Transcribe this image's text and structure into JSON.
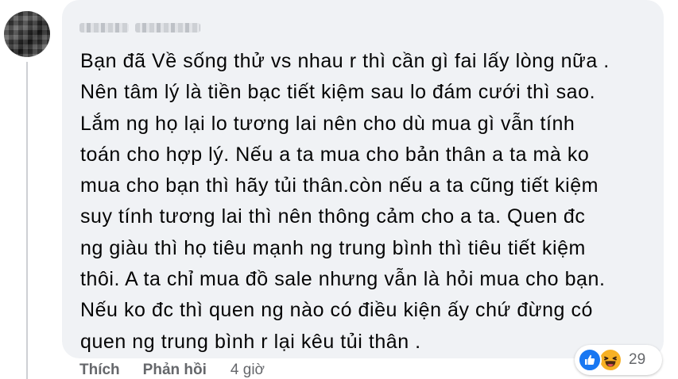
{
  "comment": {
    "author": "",
    "lines": [
      "Bạn đã Về sống thử vs nhau r thì cần gì fai lấy lòng nữa .",
      "Nên tâm lý là tiền bạc tiết kiệm sau lo đám cưới thì sao.",
      "Lắm ng họ lại lo tương lai nên cho dù mua gì vẫn tính",
      "toán cho hợp lý. Nếu a ta mua cho bản thân a ta mà ko",
      "mua cho bạn thì hãy tủi thân.còn nếu a ta cũng tiết kiệm",
      "suy tính tương lai thì nên thông cảm cho a ta. Quen đc",
      "ng giàu thì họ tiêu mạnh ng trung bình thì tiêu tiết kiệm",
      "thôi. A ta chỉ mua đồ sale nhưng vẫn là hỏi mua cho bạn.",
      "Nếu ko đc thì quen ng nào có điều kiện ấy chứ đừng có",
      "quen ng trung bình r lại kêu tủi thân ."
    ]
  },
  "actions": {
    "like_label": "Thích",
    "reply_label": "Phản hồi",
    "timestamp": "4 giờ"
  },
  "reactions": {
    "icons": [
      "like-icon",
      "haha-icon"
    ],
    "count": "29",
    "colors": {
      "like": "#1877f2",
      "haha": "#f7b125"
    }
  },
  "colors": {
    "bubble": "#f0f2f5",
    "text": "#050505",
    "secondary": "#65676b"
  }
}
